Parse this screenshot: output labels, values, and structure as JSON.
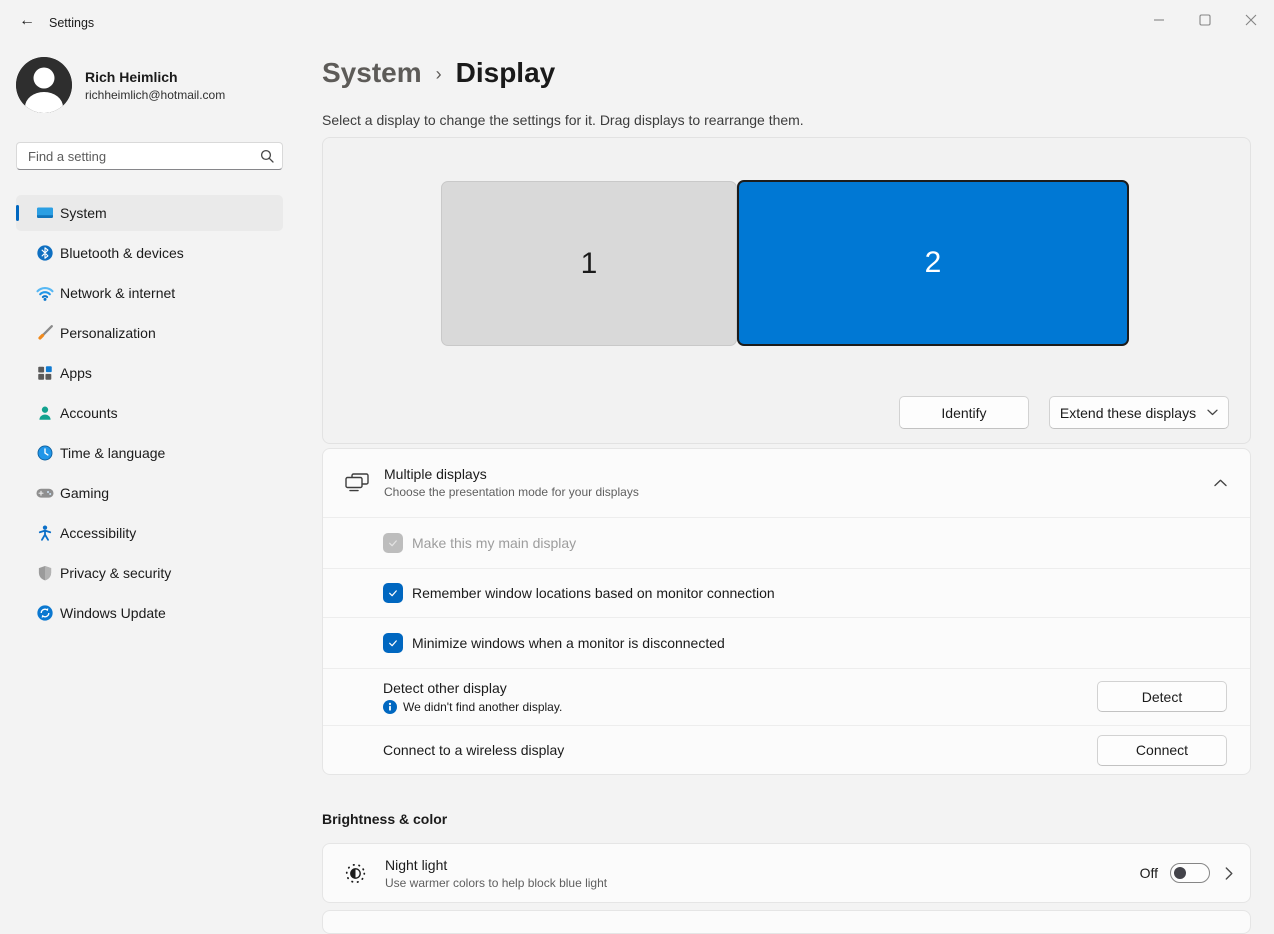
{
  "window": {
    "title": "Settings"
  },
  "sidebar": {
    "user": {
      "name": "Rich Heimlich",
      "email": "richheimlich@hotmail.com"
    },
    "search": {
      "placeholder": "Find a setting"
    },
    "items": [
      {
        "label": "System",
        "icon": "system-icon",
        "selected": true
      },
      {
        "label": "Bluetooth & devices",
        "icon": "bluetooth-icon",
        "selected": false
      },
      {
        "label": "Network & internet",
        "icon": "network-icon",
        "selected": false
      },
      {
        "label": "Personalization",
        "icon": "personalization-icon",
        "selected": false
      },
      {
        "label": "Apps",
        "icon": "apps-icon",
        "selected": false
      },
      {
        "label": "Accounts",
        "icon": "accounts-icon",
        "selected": false
      },
      {
        "label": "Time & language",
        "icon": "time-language-icon",
        "selected": false
      },
      {
        "label": "Gaming",
        "icon": "gaming-icon",
        "selected": false
      },
      {
        "label": "Accessibility",
        "icon": "accessibility-icon",
        "selected": false
      },
      {
        "label": "Privacy & security",
        "icon": "privacy-icon",
        "selected": false
      },
      {
        "label": "Windows Update",
        "icon": "windows-update-icon",
        "selected": false
      }
    ]
  },
  "main": {
    "breadcrumb": {
      "parent": "System",
      "separator": "›",
      "current": "Display"
    },
    "description": "Select a display to change the settings for it. Drag displays to rearrange them.",
    "display_arrangement": {
      "monitors": [
        {
          "number": "1",
          "selected": false
        },
        {
          "number": "2",
          "selected": true
        }
      ],
      "identify_button": "Identify",
      "mode_dropdown": {
        "value": "Extend these displays"
      }
    },
    "multiple_displays": {
      "title": "Multiple displays",
      "subtitle": "Choose the presentation mode for your displays",
      "expanded": true,
      "checkboxes": [
        {
          "label": "Make this my main display",
          "checked": true,
          "disabled": true
        },
        {
          "label": "Remember window locations based on monitor connection",
          "checked": true,
          "disabled": false
        },
        {
          "label": "Minimize windows when a monitor is disconnected",
          "checked": true,
          "disabled": false
        }
      ],
      "detect": {
        "title": "Detect other display",
        "status": "We didn't find another display.",
        "button": "Detect"
      },
      "wireless": {
        "title": "Connect to a wireless display",
        "button": "Connect"
      }
    },
    "brightness": {
      "header": "Brightness & color",
      "night_light": {
        "title": "Night light",
        "subtitle": "Use warmer colors to help block blue light",
        "state": "Off"
      }
    }
  },
  "colors": {
    "accent": "#0067c0",
    "monitor_selected_fill": "#0078d4",
    "monitor_unselected_fill": "#d9d9d9",
    "page_background": "#f3f3f3",
    "card_background": "#fbfbfb"
  }
}
